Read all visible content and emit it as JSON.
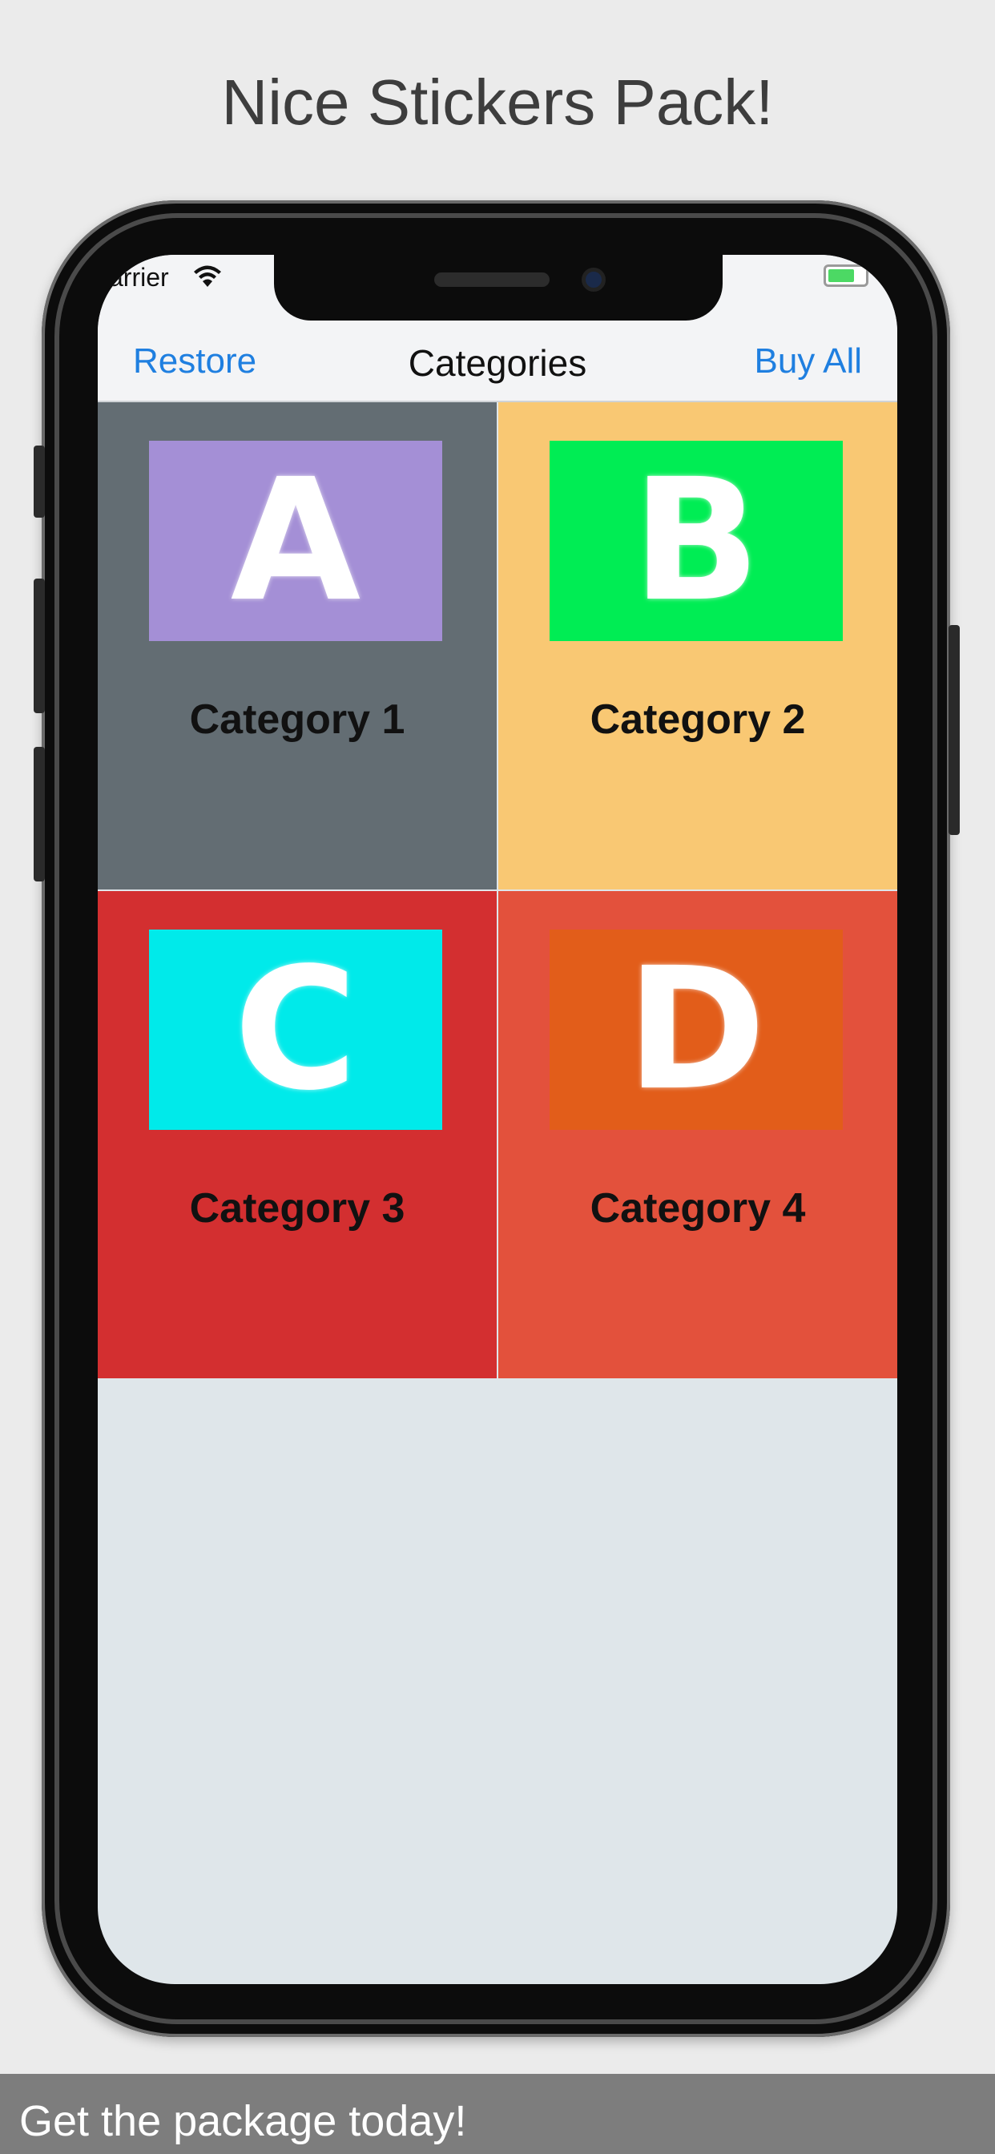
{
  "headline": "Nice Stickers Pack!",
  "status_bar": {
    "carrier": "arrier",
    "wifi_icon": "wifi-icon",
    "battery_icon": "battery-icon"
  },
  "nav": {
    "left": "Restore",
    "title": "Categories",
    "right": "Buy All"
  },
  "categories": [
    {
      "letter": "A",
      "label": "Category 1",
      "cell_color": "#636d73",
      "thumb_color": "#a48fd6"
    },
    {
      "letter": "B",
      "label": "Category 2",
      "cell_color": "#f9c873",
      "thumb_color": "#00ed54"
    },
    {
      "letter": "C",
      "label": "Category 3",
      "cell_color": "#d32f30",
      "thumb_color": "#00eaea"
    },
    {
      "letter": "D",
      "label": "Category 4",
      "cell_color": "#e3513c",
      "thumb_color": "#e25d1a"
    }
  ],
  "footer": {
    "text": "Get the package today!"
  },
  "colors": {
    "accent": "#1f7fe0",
    "background": "#ebebeb"
  }
}
